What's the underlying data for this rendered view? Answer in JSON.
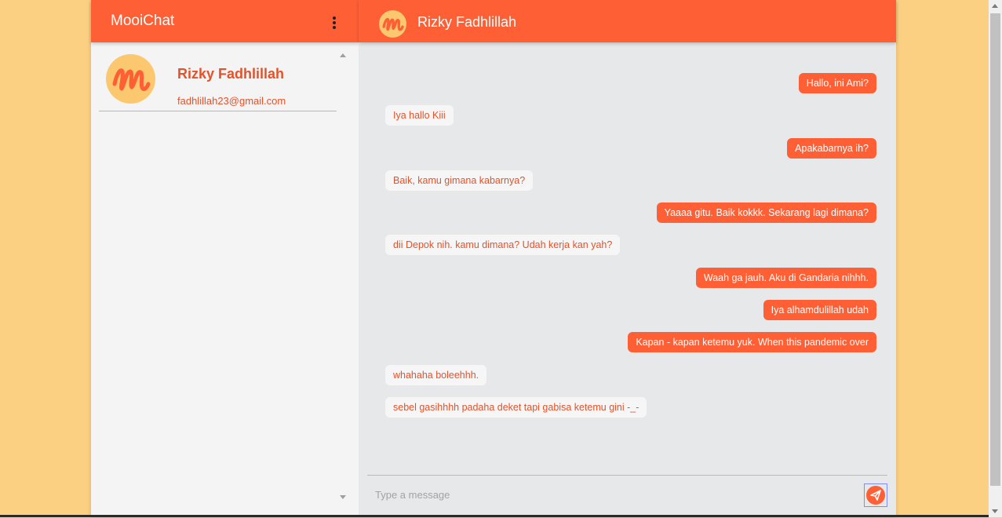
{
  "sidebar": {
    "app_title": "MooiChat",
    "menu_icon": "kebab-menu-icon",
    "contacts": [
      {
        "name": "Rizky Fadhlillah",
        "email": "fadhlillah23@gmail.com",
        "avatar_icon": "mooichat-logo-icon"
      }
    ]
  },
  "chat": {
    "header_name": "Rizky Fadhlillah",
    "messages": [
      {
        "direction": "out",
        "text": "Hallo, ini Ami?"
      },
      {
        "direction": "in",
        "text": "Iya hallo Kiii"
      },
      {
        "direction": "out",
        "text": "Apakabarnya ih?"
      },
      {
        "direction": "in",
        "text": "Baik, kamu gimana kabarnya?"
      },
      {
        "direction": "out",
        "text": "Yaaaa gitu. Baik kokkk. Sekarang lagi dimana?"
      },
      {
        "direction": "in",
        "text": "dii Depok nih. kamu dimana? Udah kerja kan yah?"
      },
      {
        "direction": "out",
        "text": "Waah ga jauh. Aku di Gandaria nihhh."
      },
      {
        "direction": "out",
        "text": "Iya alhamdulillah udah"
      },
      {
        "direction": "out",
        "text": "Kapan - kapan ketemu yuk. When this pandemic over"
      },
      {
        "direction": "in",
        "text": "whahaha boleehhh."
      },
      {
        "direction": "in",
        "text": "sebel gasihhhh padaha deket tapi gabisa ketemu gini -_-"
      }
    ],
    "input": {
      "placeholder": "Type a message",
      "value": ""
    },
    "send_icon": "send-icon"
  },
  "colors": {
    "accent": "#ff5f35",
    "page_background": "#fcd083",
    "avatar": "#fbc76f",
    "sidebar_background": "#f4f4f4",
    "chat_background": "#e6e8ea"
  }
}
